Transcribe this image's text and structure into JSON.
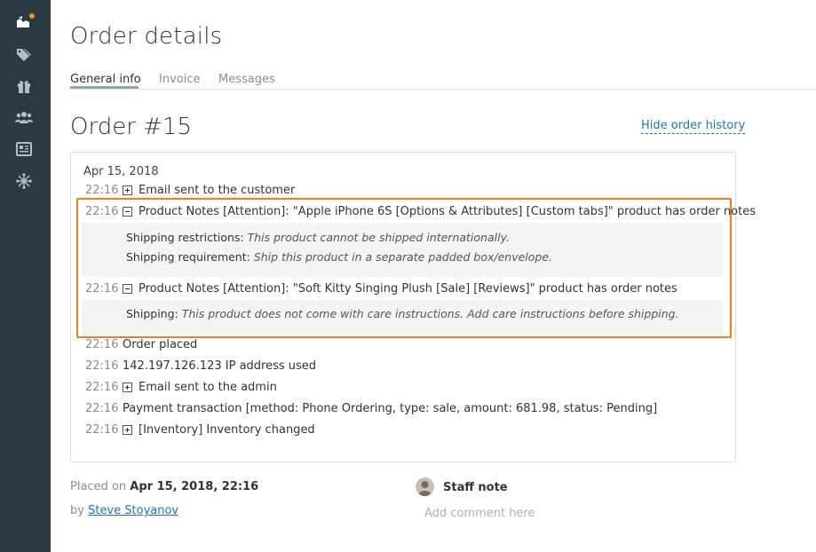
{
  "sidebar": {
    "items": [
      {
        "icon": "store-icon",
        "active": true,
        "badge_color": "#f7931e"
      },
      {
        "icon": "tags-icon"
      },
      {
        "icon": "gift-icon"
      },
      {
        "icon": "users-icon"
      },
      {
        "icon": "news-icon"
      },
      {
        "icon": "network-icon"
      }
    ]
  },
  "page": {
    "title": "Order details",
    "tabs": [
      {
        "label": "General info",
        "active": true
      },
      {
        "label": "Invoice"
      },
      {
        "label": "Messages"
      }
    ]
  },
  "order": {
    "title": "Order #15",
    "hide_history_label": "Hide order history"
  },
  "history": {
    "date": "Apr 15, 2018",
    "events": [
      {
        "time": "22:16",
        "toggle": "plus",
        "text": "Email sent to the customer"
      },
      {
        "time": "22:16",
        "toggle": "minus",
        "text": "Product Notes [Attention]: \"Apple iPhone 6S [Options & Attributes] [Custom tabs]\" product has order notes",
        "details": [
          {
            "label": "Shipping restrictions:",
            "value": "This product cannot be shipped internationally."
          },
          {
            "label": "Shipping requirement:",
            "value": "Ship this product in a separate padded box/envelope."
          }
        ]
      },
      {
        "time": "22:16",
        "toggle": "minus",
        "text": "Product Notes [Attention]: \"Soft Kitty Singing Plush [Sale] [Reviews]\" product has order notes",
        "details": [
          {
            "label": "Shipping:",
            "value": "This product does not come with care instructions. Add care instructions before shipping."
          }
        ]
      },
      {
        "time": "22:16",
        "text": "Order placed"
      },
      {
        "time": "22:16",
        "text": "142.197.126.123 IP address used"
      },
      {
        "time": "22:16",
        "toggle": "plus",
        "text": "Email sent to the admin"
      },
      {
        "time": "22:16",
        "text": "Payment transaction [method: Phone Ordering, type: sale, amount: 681.98, status: Pending]"
      },
      {
        "time": "22:16",
        "toggle": "plus",
        "text": "[Inventory] Inventory changed"
      }
    ]
  },
  "footer": {
    "placed_prefix": "Placed on",
    "placed_date": "Apr 15, 2018, 22:16",
    "by_prefix": "by",
    "by_name": "Steve Stoyanov",
    "staff_note_label": "Staff note",
    "comment_placeholder": "Add comment here"
  },
  "colors": {
    "sidebar_bg": "#2b3a42",
    "accent_orange": "#f07f1b",
    "link_blue": "#1e73be"
  }
}
